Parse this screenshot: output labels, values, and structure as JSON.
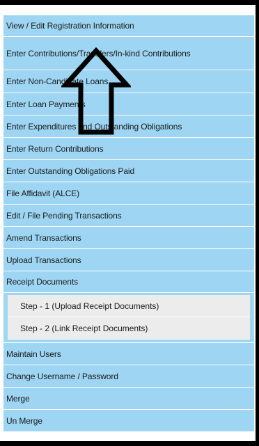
{
  "menu": {
    "items": [
      {
        "label": "View / Edit Registration Information"
      },
      {
        "label": "Enter Contributions/Transfers/In-kind Contributions"
      },
      {
        "label": "Enter Non-Candidate Loans"
      },
      {
        "label": "Enter Loan Payments"
      },
      {
        "label": "Enter Expenditures and Outstanding Obligations"
      },
      {
        "label": "Enter Return Contributions"
      },
      {
        "label": "Enter Outstanding Obligations Paid"
      },
      {
        "label": "File Affidavit (ALCE)"
      },
      {
        "label": "Edit / File Pending Transactions"
      },
      {
        "label": "Amend Transactions"
      },
      {
        "label": "Upload Transactions"
      },
      {
        "label": "Receipt Documents"
      }
    ],
    "subitems": [
      {
        "label": "Step - 1 (Upload Receipt Documents)"
      },
      {
        "label": "Step - 2 (Link Receipt Documents)"
      }
    ],
    "items_after": [
      {
        "label": "Maintain Users"
      },
      {
        "label": "Change Username / Password"
      },
      {
        "label": "Merge"
      },
      {
        "label": "Un Merge"
      }
    ]
  },
  "colors": {
    "menu_bg": "#9dd5f3",
    "submenu_bg": "#ececec",
    "arrow_stroke": "#000000"
  },
  "annotation": {
    "icon": "up-arrow-icon"
  }
}
